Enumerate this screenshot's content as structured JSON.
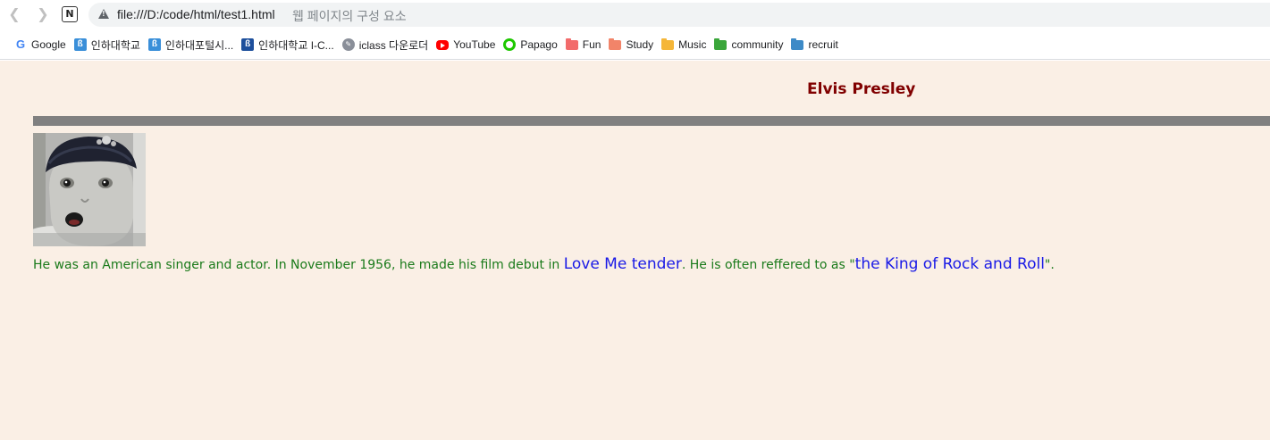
{
  "browser": {
    "url": "file:///D:/code/html/test1.html",
    "tab_title": "웹 페이지의 구성 요소",
    "notion_glyph": "N",
    "back_icon": "arrow-left-icon",
    "forward_icon": "arrow-right-icon"
  },
  "bookmarks": [
    {
      "label": "Google",
      "icon": "google-icon"
    },
    {
      "label": "인하대학교",
      "icon": "inha-icon"
    },
    {
      "label": "인하대포털시...",
      "icon": "inha-icon"
    },
    {
      "label": "인하대학교 I-C...",
      "icon": "inha-icon"
    },
    {
      "label": "iclass 다운로더",
      "icon": "iclass-icon"
    },
    {
      "label": "YouTube",
      "icon": "youtube-icon"
    },
    {
      "label": "Papago",
      "icon": "papago-icon"
    },
    {
      "label": "Fun",
      "icon": "folder-icon",
      "color": "#f26b6b"
    },
    {
      "label": "Study",
      "icon": "folder-icon",
      "color": "#f28469"
    },
    {
      "label": "Music",
      "icon": "folder-icon",
      "color": "#f5b638"
    },
    {
      "label": "community",
      "icon": "folder-icon",
      "color": "#3aa63a"
    },
    {
      "label": "recruit",
      "icon": "folder-icon",
      "color": "#3d8ac7"
    }
  ],
  "page": {
    "title": "Elvis Presley",
    "paragraph": {
      "part1": "He was an American singer and actor. In November 1956, he made his film debut in ",
      "movie": "Love Me tender",
      "part2": ". He is often reffered to as \"",
      "nickname": "the King of Rock and Roll",
      "part3": "\"."
    },
    "colors": {
      "background": "#faefe5",
      "title": "#800000",
      "rule": "#808080",
      "text": "#1a7a1a",
      "emphasis": "#1a1ae6"
    }
  }
}
